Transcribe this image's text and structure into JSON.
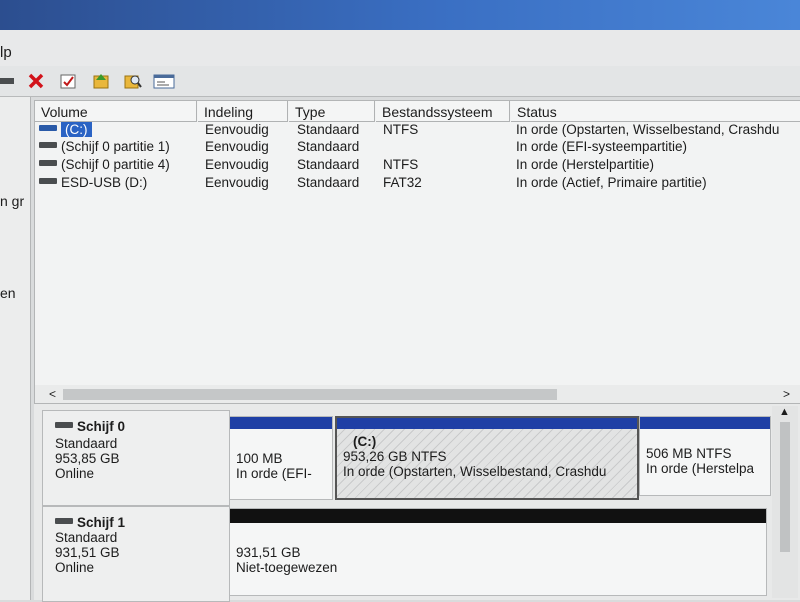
{
  "menu": {
    "partial_item": "lp"
  },
  "toolbar": {
    "icons": [
      "drive-icon",
      "delete-icon",
      "properties-icon",
      "help-icon",
      "search-icon",
      "console-icon"
    ]
  },
  "left_panel": {
    "fragment_1": "n gr",
    "fragment_2": "en"
  },
  "columns": [
    "Volume",
    "Indeling",
    "Type",
    "Bestandssysteem",
    "Status"
  ],
  "volumes": [
    {
      "name": "(C:)",
      "layout": "Eenvoudig",
      "type": "Standaard",
      "fs": "NTFS",
      "status": "In orde (Opstarten, Wisselbestand, Crashdu"
    },
    {
      "name": "(Schijf 0 partitie 1)",
      "layout": "Eenvoudig",
      "type": "Standaard",
      "fs": "",
      "status": "In orde (EFI-systeempartitie)"
    },
    {
      "name": "(Schijf 0 partitie 4)",
      "layout": "Eenvoudig",
      "type": "Standaard",
      "fs": "NTFS",
      "status": "In orde (Herstelpartitie)"
    },
    {
      "name": "ESD-USB (D:)",
      "layout": "Eenvoudig",
      "type": "Standaard",
      "fs": "FAT32",
      "status": "In orde (Actief, Primaire partitie)"
    }
  ],
  "disks": [
    {
      "name": "Schijf 0",
      "kind": "Standaard",
      "size": "953,85 GB",
      "state": "Online",
      "partitions": [
        {
          "title": "",
          "line1": "100 MB",
          "line2": "In orde (EFI-"
        },
        {
          "title": "(C:)",
          "line1": "953,26 GB NTFS",
          "line2": "In orde (Opstarten, Wisselbestand, Crashdu"
        },
        {
          "title": "",
          "line1": "506 MB NTFS",
          "line2": "In orde (Herstelpa"
        }
      ]
    },
    {
      "name": "Schijf 1",
      "kind": "Standaard",
      "size": "931,51 GB",
      "state": "Online",
      "partitions": [
        {
          "title": "",
          "line1": "931,51 GB",
          "line2": "Niet-toegewezen"
        }
      ]
    }
  ]
}
